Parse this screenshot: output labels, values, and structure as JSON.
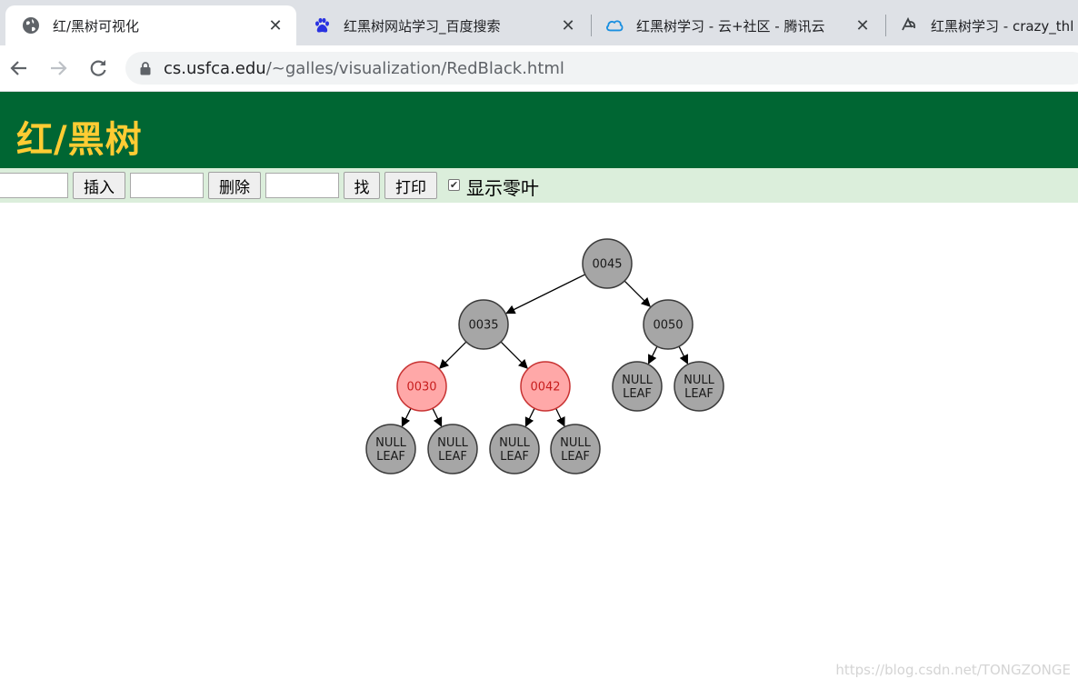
{
  "browser": {
    "tabs": [
      {
        "title": "红/黑树可视化",
        "icon": "globe-icon",
        "active": true
      },
      {
        "title": "红黑树网站学习_百度搜索",
        "icon": "baidu-paw-icon",
        "active": false
      },
      {
        "title": "红黑树学习 - 云+社区 - 腾讯云",
        "icon": "tencent-cloud-icon",
        "active": false
      },
      {
        "title": "红黑树学习 - crazy_thl",
        "icon": "csdn-icon",
        "active": false
      }
    ],
    "close_glyph": "✕",
    "url_host": "cs.usfca.edu",
    "url_path": "/~galles/visualization/RedBlack.html"
  },
  "page": {
    "title": "红/黑树",
    "controls": {
      "insert_input": "",
      "insert_label": "插入",
      "delete_input": "",
      "delete_label": "删除",
      "find_input": "",
      "find_label": "找",
      "print_label": "打印",
      "show_null_leaves_checked": true,
      "show_null_leaves_label": "显示零叶"
    },
    "tree": {
      "nodes": [
        {
          "id": "n45",
          "label": "0045",
          "color": "black"
        },
        {
          "id": "n35",
          "label": "0035",
          "color": "black"
        },
        {
          "id": "n50",
          "label": "0050",
          "color": "black"
        },
        {
          "id": "n30",
          "label": "0030",
          "color": "red"
        },
        {
          "id": "n42",
          "label": "0042",
          "color": "red"
        },
        {
          "id": "l1",
          "label": "NULL LEAF",
          "color": "null"
        },
        {
          "id": "l2",
          "label": "NULL LEAF",
          "color": "null"
        },
        {
          "id": "l3",
          "label": "NULL LEAF",
          "color": "null"
        },
        {
          "id": "l4",
          "label": "NULL LEAF",
          "color": "null"
        },
        {
          "id": "l5",
          "label": "NULL LEAF",
          "color": "null"
        },
        {
          "id": "l6",
          "label": "NULL LEAF",
          "color": "null"
        }
      ],
      "edges": [
        [
          "n45",
          "n35"
        ],
        [
          "n45",
          "n50"
        ],
        [
          "n35",
          "n30"
        ],
        [
          "n35",
          "n42"
        ],
        [
          "n50",
          "l5"
        ],
        [
          "n50",
          "l6"
        ],
        [
          "n30",
          "l1"
        ],
        [
          "n30",
          "l2"
        ],
        [
          "n42",
          "l3"
        ],
        [
          "n42",
          "l4"
        ]
      ],
      "colors": {
        "black_fill": "#a6a6a6",
        "black_stroke": "#3a3a3a",
        "black_text": "#1a1a1a",
        "red_fill": "#ffa8a8",
        "red_stroke": "#c83232",
        "red_text": "#c81e1e"
      }
    }
  },
  "watermark": "https://blog.csdn.net/TONGZONGE",
  "colors": {
    "header_bg": "#006633",
    "header_title": "#ffcc33",
    "controls_bg": "#dbeedb"
  }
}
